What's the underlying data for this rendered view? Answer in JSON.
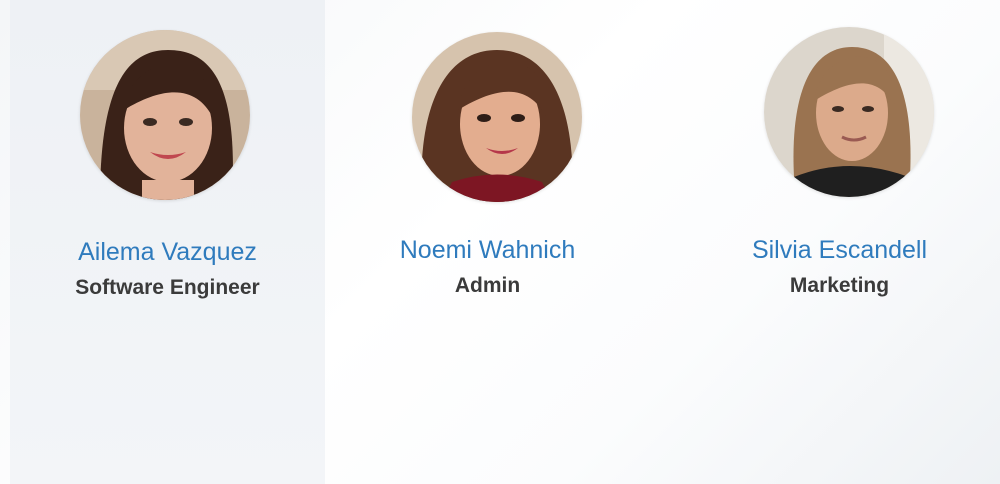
{
  "team": {
    "members": [
      {
        "name": "Ailema Vazquez",
        "role": "Software Engineer",
        "avatar_icon": "profile-photo",
        "active": true
      },
      {
        "name": "Noemi Wahnich",
        "role": "Admin",
        "avatar_icon": "profile-photo",
        "active": false
      },
      {
        "name": "Silvia Escandell",
        "role": "Marketing",
        "avatar_icon": "profile-photo",
        "active": false
      }
    ]
  },
  "colors": {
    "name_text": "#2f7bbd",
    "role_text": "#3b3b3b",
    "active_card_bg": "#eef1f5"
  }
}
